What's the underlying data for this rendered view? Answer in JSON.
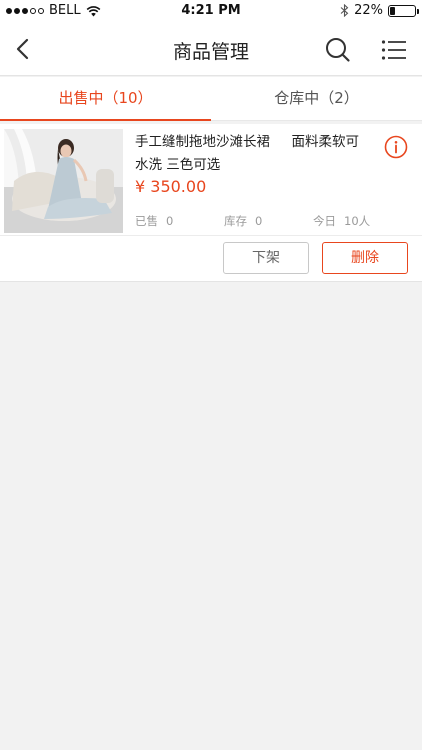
{
  "status_bar": {
    "carrier": "BELL",
    "time": "4:21 PM",
    "battery_percent": "22%",
    "battery_level": 0.22,
    "signal_dots_filled": 3,
    "signal_dots_total": 5
  },
  "nav": {
    "title": "商品管理",
    "back_icon": "chevron-left-icon",
    "search_icon": "search-icon",
    "menu_icon": "list-menu-icon"
  },
  "tabs": [
    {
      "label": "出售中（10）",
      "active": true
    },
    {
      "label": "仓库中（2）",
      "active": false
    }
  ],
  "product": {
    "title": "手工缝制拖地沙滩长裙     面料柔软可水洗 三色可选",
    "price": "¥ 350.00",
    "stats": {
      "sold_label": "已售",
      "sold_value": "0",
      "stock_label": "库存",
      "stock_value": "0",
      "today_label": "今日",
      "today_value": "10人"
    },
    "actions": {
      "delist_label": "下架",
      "delete_label": "删除"
    }
  },
  "colors": {
    "accent": "#e8461e",
    "background": "#f2f2f2",
    "muted_text": "#9a9a9a"
  }
}
